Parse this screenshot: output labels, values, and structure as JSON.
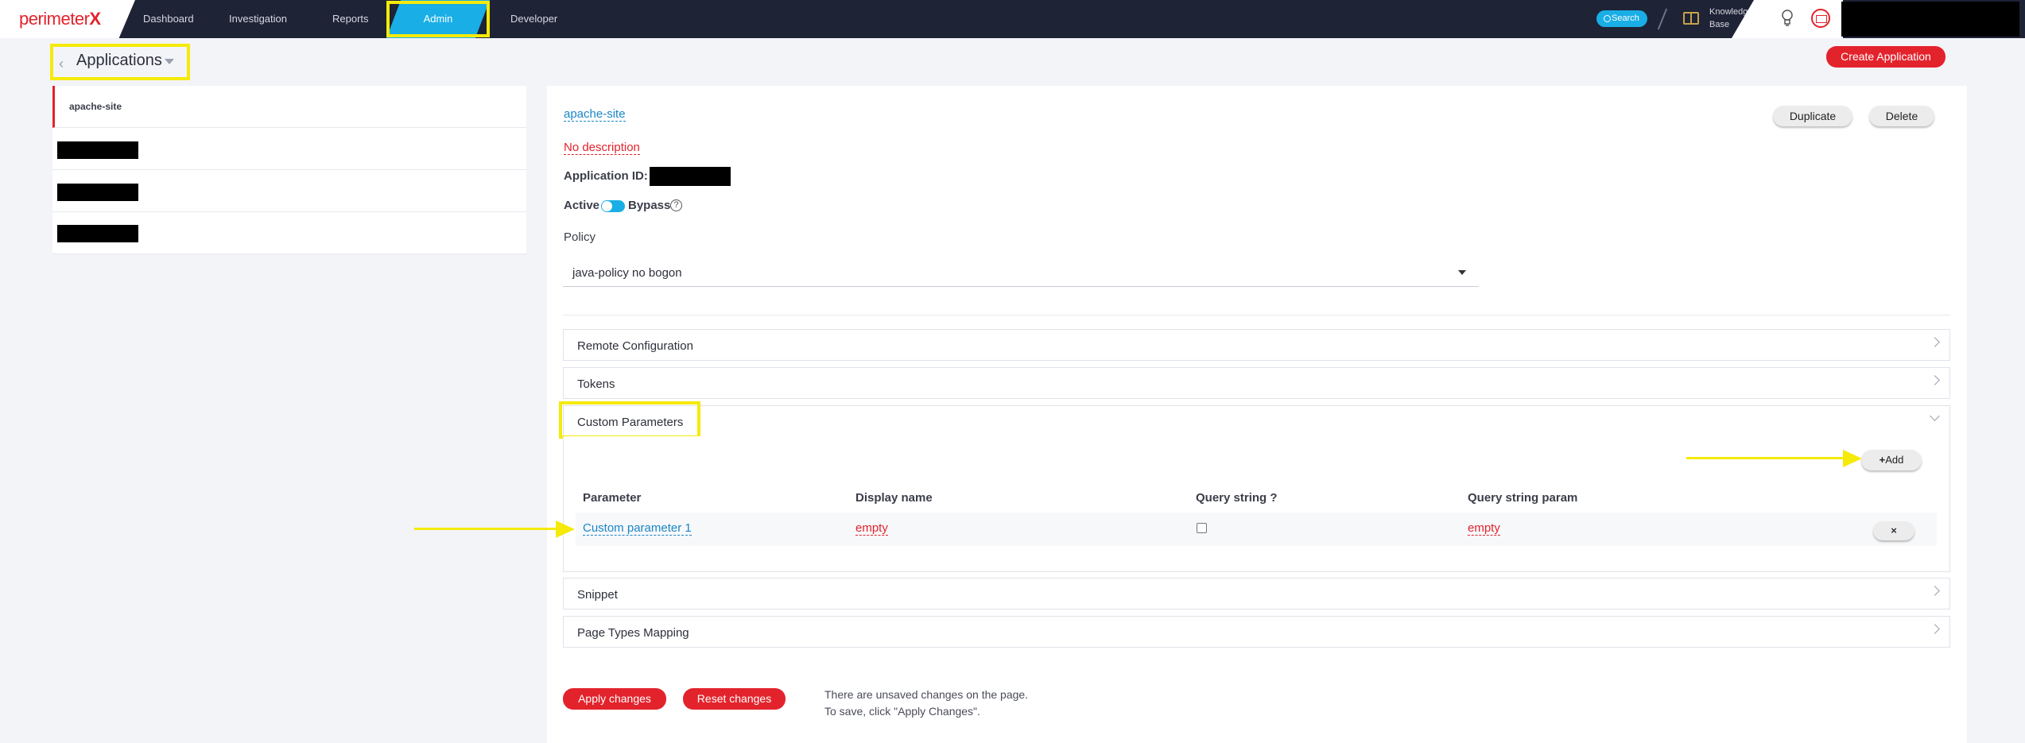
{
  "topnav": {
    "logo_text": "perimeter",
    "logo_mark": "X",
    "items": [
      "Dashboard",
      "Investigation",
      "Reports",
      "Admin",
      "Developer"
    ],
    "active": "Admin",
    "search_label": "Search",
    "kb_line1": "Knowledge",
    "kb_line2": "Base"
  },
  "breadcrumb": {
    "title": "Applications"
  },
  "create_button": "Create Application",
  "app_list": {
    "items": [
      "apache-site"
    ]
  },
  "detail": {
    "app_name": "apache-site",
    "description": "No description",
    "app_id_label": "Application ID:",
    "active_label": "Active",
    "bypass_label": "Bypass",
    "help": "?",
    "policy_label": "Policy",
    "policy_value": "java-policy no bogon",
    "duplicate": "Duplicate",
    "delete": "Delete"
  },
  "sections": {
    "remote": "Remote Configuration",
    "tokens": "Tokens",
    "custom": "Custom Parameters",
    "snippet": "Snippet",
    "page_types": "Page Types Mapping"
  },
  "custom_params": {
    "add_label": "Add",
    "columns": [
      "Parameter",
      "Display name",
      "Query string ?",
      "Query string param"
    ],
    "rows": [
      {
        "parameter": "Custom parameter 1",
        "display_name": "empty",
        "query_string": false,
        "query_param": "empty"
      }
    ],
    "remove_label": "×"
  },
  "footer": {
    "apply": "Apply changes",
    "reset": "Reset changes",
    "notice1": "There are unsaved changes on the page.",
    "notice2": "To save, click \"Apply Changes\"."
  },
  "colors": {
    "accent_blue": "#1aaee6",
    "brand_red": "#e3232c",
    "nav_bg": "#1e2336",
    "highlight": "#f5ea0a"
  }
}
